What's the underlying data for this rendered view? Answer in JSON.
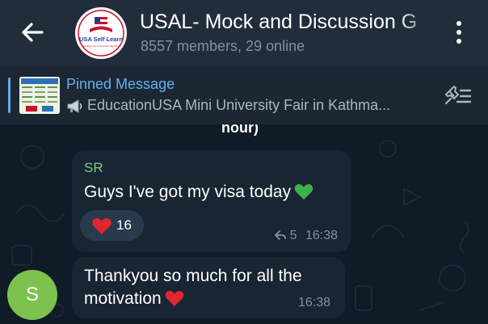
{
  "header": {
    "title": "USAL- Mock and Discussion G",
    "subtitle": "8557 members, 29 online",
    "avatar_text": "USA Self Learn",
    "avatar_subtext": "Guiding You to Success Together"
  },
  "pinned": {
    "title": "Pinned Message",
    "text": "EducationUSA Mini University Fair in Kathma...",
    "icon": "megaphone-icon"
  },
  "chat": {
    "date_fragment": "hour)",
    "messages": [
      {
        "sender": "SR",
        "text": "Guys I've got my visa today",
        "emoji": "green-heart",
        "reaction_count": "16",
        "forwards": "5",
        "time": "16:38"
      },
      {
        "text": "Thankyou so much for all the motivation",
        "emoji": "red-heart",
        "time": "16:38",
        "avatar_letter": "S"
      }
    ]
  },
  "colors": {
    "header_bg": "#212d3b",
    "chat_bg": "#0e1621",
    "bubble_bg": "#182533",
    "accent": "#5fb2f0",
    "sender_name": "#7ad07c",
    "avatar_bg": "#7dc24e"
  }
}
